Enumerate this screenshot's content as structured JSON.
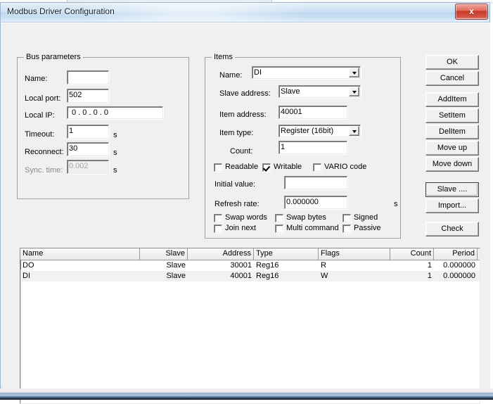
{
  "window": {
    "title": "Modbus Driver Configuration",
    "close_label": "x",
    "close_icon": "close-icon"
  },
  "bus_parameters": {
    "legend": "Bus parameters",
    "fields": [
      {
        "label": "Name:",
        "value": "",
        "unit": "",
        "disabled": false
      },
      {
        "label": "Local port:",
        "value": "502",
        "unit": "",
        "disabled": false
      },
      {
        "label": "Local IP:",
        "value": "0  .  0  .  0  .  0",
        "unit": "",
        "disabled": false
      },
      {
        "label": "Timeout:",
        "value": "1",
        "unit": "s",
        "disabled": false
      },
      {
        "label": "Reconnect:",
        "value": "30",
        "unit": "s",
        "disabled": false
      },
      {
        "label": "Sync. time:",
        "value": "0.002",
        "unit": "s",
        "disabled": true
      }
    ]
  },
  "items": {
    "legend": "Items",
    "name_label": "Name:",
    "name_value": "DI",
    "slave_address_label": "Slave address:",
    "slave_address_value": "Slave",
    "item_address_label": "Item address:",
    "item_address_value": "40001",
    "item_type_label": "Item type:",
    "item_type_value": "Register (16bit)",
    "count_label": "Count:",
    "count_value": "1",
    "initial_value_label": "Initial value:",
    "initial_value_value": "",
    "refresh_rate_label": "Refresh rate:",
    "refresh_rate_value": "0.000000",
    "refresh_rate_unit": "s",
    "checkboxes": [
      {
        "label": "Readable",
        "checked": false
      },
      {
        "label": "Writable",
        "checked": true
      },
      {
        "label": "VARIO code",
        "checked": false
      },
      {
        "label": "Swap words",
        "checked": false
      },
      {
        "label": "Swap bytes",
        "checked": false
      },
      {
        "label": "Signed",
        "checked": false
      },
      {
        "label": "Join next",
        "checked": false
      },
      {
        "label": "Multi command",
        "checked": false
      },
      {
        "label": "Passive",
        "checked": false
      }
    ]
  },
  "buttons": {
    "ok": "OK",
    "cancel": "Cancel",
    "add_item": "AddItem",
    "set_item": "SetItem",
    "del_item": "DelItem",
    "move_up": "Move up",
    "move_down": "Move down",
    "slave": "Slave ....",
    "import": "Import...",
    "check": "Check"
  },
  "table": {
    "columns": [
      {
        "label": "Name",
        "align": "left",
        "width": 170
      },
      {
        "label": "Slave",
        "align": "right",
        "width": 68
      },
      {
        "label": "Address",
        "align": "right",
        "width": 94
      },
      {
        "label": "Type",
        "align": "left",
        "width": 92
      },
      {
        "label": "Flags",
        "align": "left",
        "width": 102
      },
      {
        "label": "Count",
        "align": "right",
        "width": 62
      },
      {
        "label": "Period",
        "align": "right",
        "width": 62
      }
    ],
    "rows": [
      {
        "cells": [
          "DO",
          "Slave",
          "30001",
          "Reg16",
          "R",
          "1",
          "0.000000"
        ]
      },
      {
        "cells": [
          "DI",
          "Slave",
          "40001",
          "Reg16",
          "W",
          "1",
          "0.000000"
        ]
      }
    ]
  },
  "background": {
    "behind_window_text": "...."
  }
}
